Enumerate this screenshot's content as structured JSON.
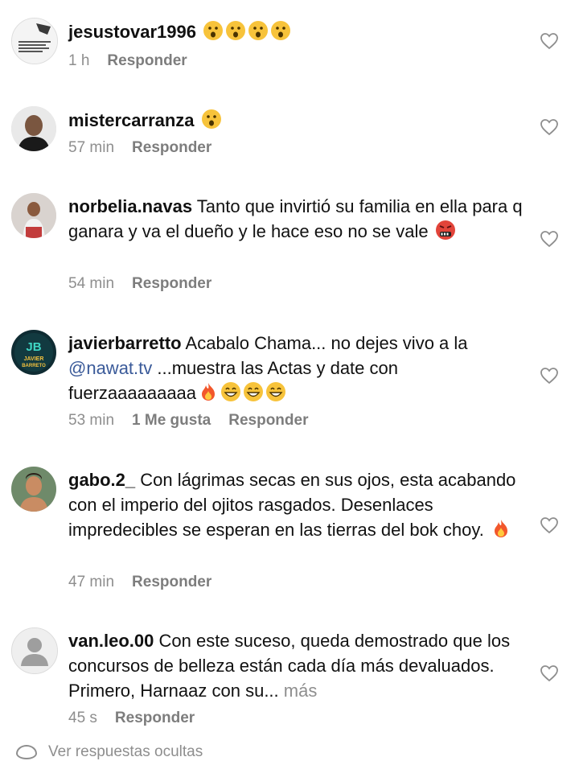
{
  "comments": [
    {
      "username": "jesustovar1996",
      "text": "",
      "emojis": [
        "hushed",
        "hushed",
        "hushed",
        "hushed"
      ],
      "time": "1 h",
      "likes": "",
      "reply": "Responder",
      "avatar": "newspaper-clipping"
    },
    {
      "username": "mistercarranza",
      "text": "",
      "emojis": [
        "hushed"
      ],
      "time": "57 min",
      "likes": "",
      "reply": "Responder",
      "avatar": "man-portrait"
    },
    {
      "username": "norbelia.navas",
      "text": "Tanto que invirtió su familia en ella para q ganara y va el dueño y le hace eso no se vale",
      "emojis": [
        "swearing"
      ],
      "time": "54 min",
      "likes": "",
      "reply": "Responder",
      "avatar": "woman-portrait"
    },
    {
      "username": "javierbarretto",
      "text_before": "Acabalo Chama... no dejes vivo a la",
      "mention": "@nawat.tv",
      "text_after": "...muestra las Actas y date con fuerzaaaaaaaaa",
      "emojis": [
        "fire",
        "grin",
        "grin",
        "grin"
      ],
      "time": "53 min",
      "likes": "1 Me gusta",
      "reply": "Responder",
      "avatar": "jb-logo"
    },
    {
      "username": "gabo.2_",
      "text": "Con lágrimas secas en sus ojos, esta acabando con el imperio del ojitos rasgados. Desenlaces impredecibles se esperan en las tierras del bok choy.",
      "emojis": [
        "fire"
      ],
      "time": "47 min",
      "likes": "",
      "reply": "Responder",
      "avatar": "man-selfie"
    },
    {
      "username": "van.leo.00",
      "text": "Con este suceso, queda demostrado que los concursos de belleza están cada día más devaluados. Primero, Harnaaz con su...",
      "more": "más",
      "time": "45 s",
      "likes": "",
      "reply": "Responder",
      "avatar": "default-user"
    }
  ],
  "footer_hint": "Ver respuestas ocultas",
  "colors": {
    "meta": "#8e8e8e",
    "mention": "#3a5a99",
    "text": "#111111"
  }
}
